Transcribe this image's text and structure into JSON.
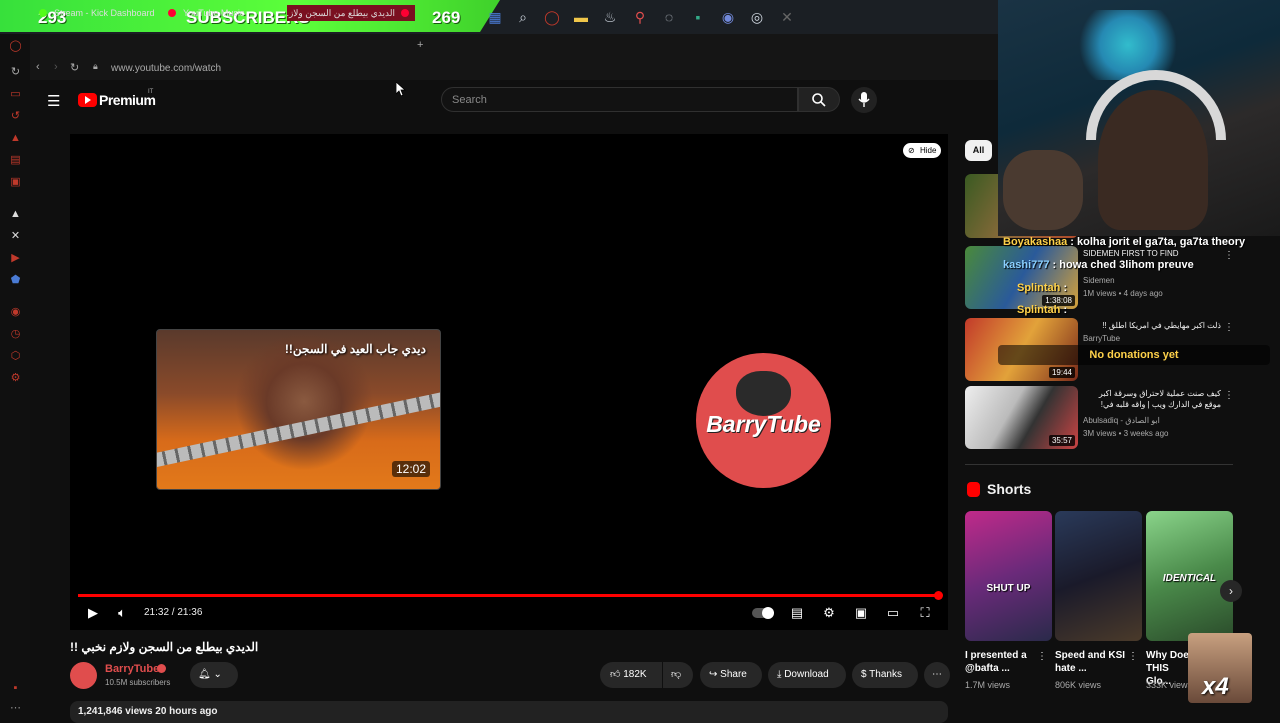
{
  "overlay": {
    "left_count": "293",
    "banner_label": "SUBSCRIBERS",
    "right_count": "269",
    "colors": {
      "banner": "#4cea34",
      "chat_name": "#ffd24a"
    }
  },
  "browser": {
    "tabs": [
      {
        "label": "Stream - Kick Dashboard",
        "icon": "kick-icon"
      },
      {
        "label": "YouTube Music",
        "icon": "youtube-music-icon"
      },
      {
        "label": "الديدي بيطلع من السجن ولاز...",
        "icon": "youtube-icon"
      }
    ],
    "url": "www.youtube.com/watch"
  },
  "youtube": {
    "brand": "Premium",
    "brand_sup": "IT",
    "search_placeholder": "Search",
    "player": {
      "hide_label": "Hide",
      "endscreen_video_title": "ديدي جاب العيد في السجن!!",
      "endscreen_video_duration": "12:02",
      "channel_logo_text": "BarryTube",
      "time": "21:32 / 21:36",
      "progress": 0.997
    },
    "video": {
      "title": "الديدي بيطلع من السجن ولازم نخبي !!",
      "channel": "BarryTube",
      "subscribers": "10.5M subscribers",
      "likes": "182K",
      "share": "Share",
      "download": "Download",
      "thanks": "Thanks",
      "views_line": "1,241,846 views  20 hours ago"
    },
    "chips": [
      "All"
    ],
    "recommendations": [
      {
        "title": "SIDEMEN FIRST TO FIND",
        "channel": "Sidemen",
        "meta": "1M views • 4 days ago",
        "duration": "1:38:08"
      },
      {
        "title": "ذلت اكبر مهايطي في امريكا اطلق !!",
        "channel": "BarryTube",
        "meta": "",
        "duration": "19:44"
      },
      {
        "title": "كيف صنت عملية لاحتراق وسرقة اكبر موقع في الدارك ويب | واقه قلبه في!",
        "channel": "Abulsadiq - ابو الصادق",
        "meta": "3M views • 3 weeks ago",
        "duration": "35:57"
      }
    ],
    "shorts_heading": "Shorts",
    "shorts": [
      {
        "title": "I presented a @bafta ...",
        "views": "1.7M views",
        "overlay": "SHUT UP"
      },
      {
        "title": "Speed and KSI hate ...",
        "views": "806K views",
        "overlay": ""
      },
      {
        "title": "Why Doe THIS Glo...",
        "views": "333K views",
        "overlay": "IDENTICAL"
      }
    ]
  },
  "stream": {
    "chat": [
      {
        "name": "Boyakashaa",
        "message": ": kolha jorit el ga7ta, ga7ta theory"
      },
      {
        "name": "kashi777",
        "message": ": howa ched 3lihom preuve"
      },
      {
        "name": "Splintah",
        "message": ":"
      },
      {
        "name": "Splintah",
        "message": ":"
      }
    ],
    "donations": "No donations yet",
    "emote_multiplier": "x4"
  }
}
